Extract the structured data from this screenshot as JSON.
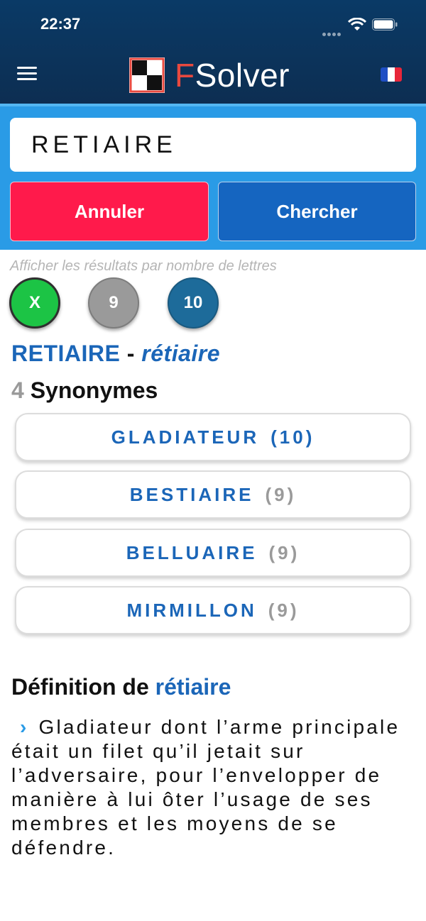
{
  "status_bar": {
    "time": "22:37"
  },
  "header": {
    "brand_first": "F",
    "brand_rest": "Solver"
  },
  "search": {
    "value": "RETIAIRE",
    "cancel_label": "Annuler",
    "search_label": "Chercher"
  },
  "filter": {
    "label": "Afficher les résultats par nombre de lettres",
    "options": [
      "X",
      "9",
      "10"
    ]
  },
  "result": {
    "word": "RETIAIRE",
    "separator": " - ",
    "word_alt": "rétiaire",
    "count": "4",
    "count_label": " Synonymes"
  },
  "synonyms": [
    {
      "word": "GLADIATEUR",
      "length": "(10)"
    },
    {
      "word": "BESTIAIRE",
      "length": "(9)"
    },
    {
      "word": "BELLUAIRE",
      "length": "(9)"
    },
    {
      "word": "MIRMILLON",
      "length": "(9)"
    }
  ],
  "definition": {
    "title_prefix": "Définition de ",
    "title_word": "rétiaire",
    "chevron": "›",
    "text": "Gladiateur dont l’arme principale était un filet qu’il jetait sur l’adversaire, pour l’envelopper de manière à lui ôter l’usage de ses membres et les moyens de se défendre."
  },
  "colors": {
    "header": "#0d2e52",
    "search_bg": "#2a9be6",
    "cancel": "#ff1a4b",
    "search": "#1565c0",
    "accent": "#1b66b8",
    "brand_f": "#e8493f"
  },
  "icons": {
    "menu": "hamburger-menu-icon",
    "logo": "checkerboard-logo-icon",
    "language": "french-flag-icon"
  }
}
